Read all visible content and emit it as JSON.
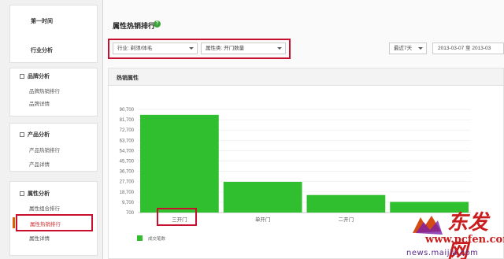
{
  "sidebar": {
    "top_items": [
      "第一时间",
      "行业分析"
    ],
    "sections": [
      {
        "title": "品牌分析",
        "items": [
          "品牌热销排行",
          "品牌详情"
        ]
      },
      {
        "title": "产品分析",
        "items": [
          "产品热销排行",
          "产品详情"
        ]
      },
      {
        "title": "属性分析",
        "items": [
          "属性组合排行",
          "属性热销排行",
          "属性详情"
        ]
      }
    ]
  },
  "main": {
    "title": "属性热销排行",
    "help_icon": "question-icon",
    "filters": {
      "industry": "行业: 剃须/体毛",
      "attribute": "属性类: 开门数量",
      "range": "最近7天",
      "date": "2013-03-07 至 2013-03"
    },
    "panel_title": "热销属性",
    "legend": "成交笔数"
  },
  "chart_data": {
    "type": "bar",
    "categories": [
      "三开门",
      "单开门",
      "二开门",
      ""
    ],
    "values": [
      86000,
      27500,
      16000,
      10000
    ],
    "yticks": [
      "90,700",
      "81,700",
      "72,700",
      "63,700",
      "54,700",
      "45,700",
      "36,700",
      "27,700",
      "18,700",
      "9,700",
      "700"
    ],
    "ylim": [
      700,
      90700
    ],
    "color": "#2fbf2f",
    "grid": true
  },
  "watermark": {
    "brand": "东发网",
    "site": "www.pcfen.com",
    "url": "news.maijia.com"
  },
  "colors": {
    "highlight": "#c8102e",
    "bar": "#2fbf2f",
    "help": "#3aa53a"
  }
}
